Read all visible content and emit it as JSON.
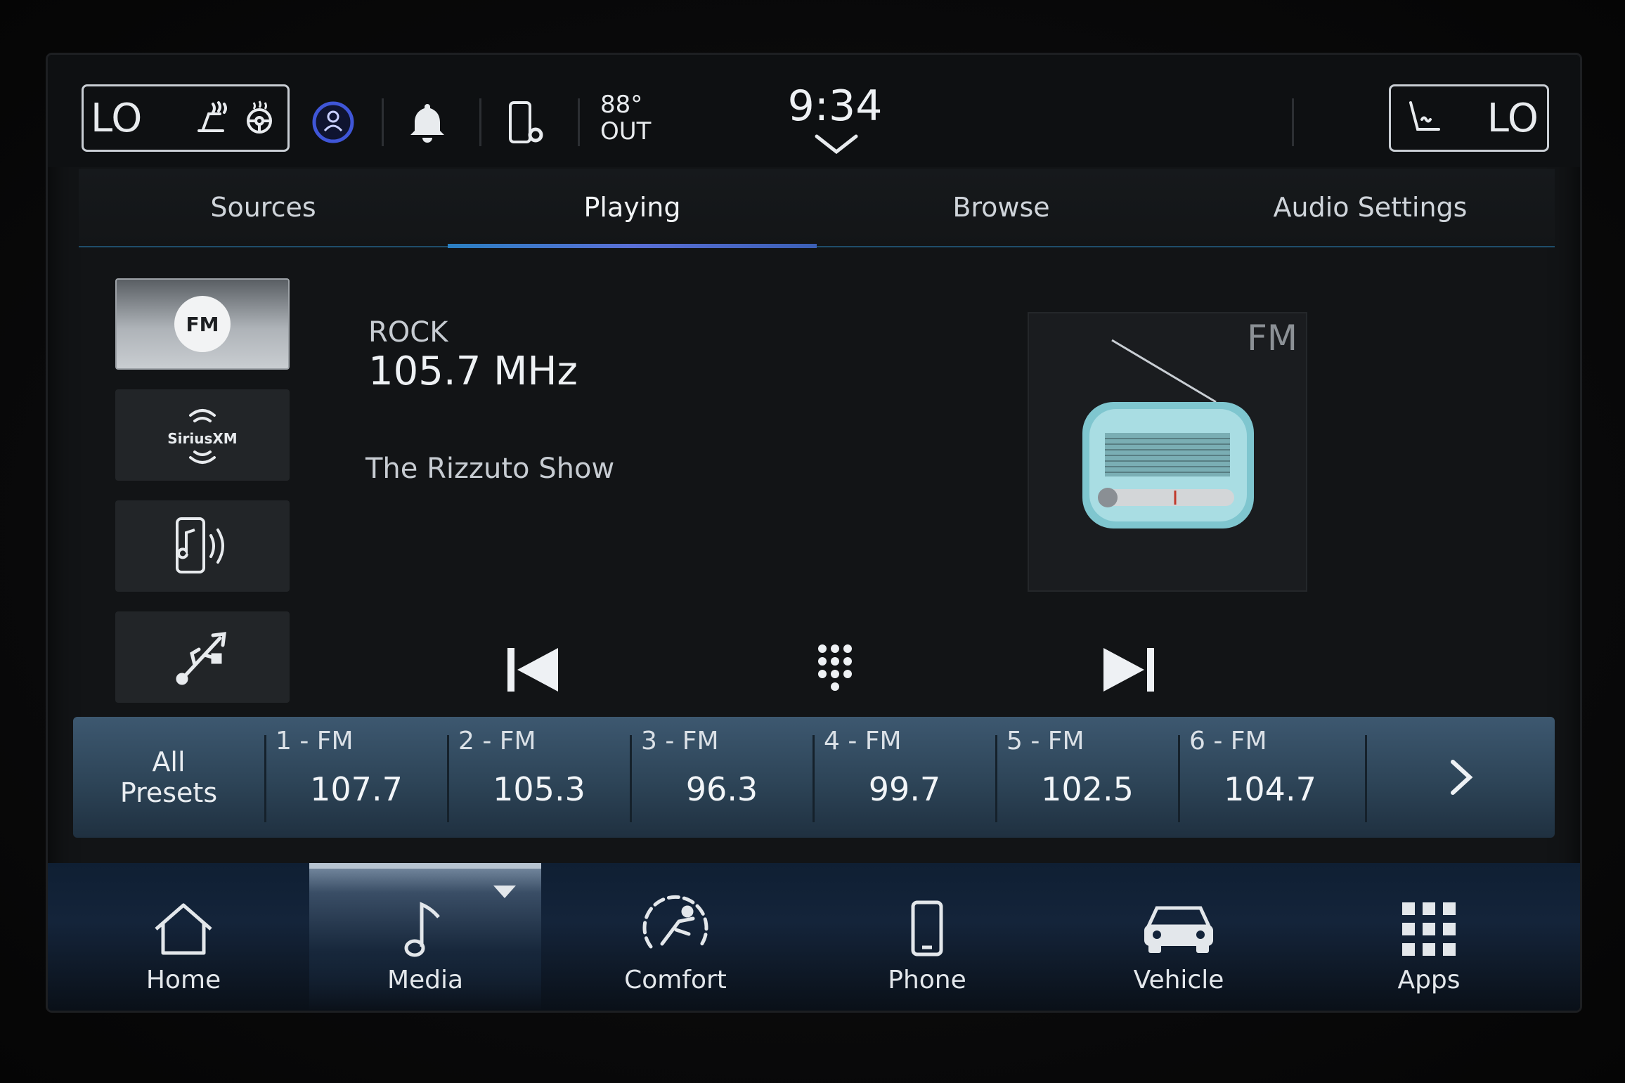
{
  "status_bar": {
    "driver_temp": "LO",
    "passenger_temp": "LO",
    "outside_temp": "88°",
    "outside_label": "OUT",
    "clock": "9:34"
  },
  "tabs": [
    {
      "label": "Sources"
    },
    {
      "label": "Playing",
      "active": true
    },
    {
      "label": "Browse"
    },
    {
      "label": "Audio Settings"
    }
  ],
  "sources": {
    "fm_label": "FM",
    "sirius_label": "SiriusXM"
  },
  "now_playing": {
    "genre": "ROCK",
    "frequency": "105.7 MHz",
    "program": "The Rizzuto Show",
    "art_label": "FM"
  },
  "presets": {
    "all_label_line1": "All",
    "all_label_line2": "Presets",
    "items": [
      {
        "name": "1 - FM",
        "value": "107.7"
      },
      {
        "name": "2 - FM",
        "value": "105.3"
      },
      {
        "name": "3 - FM",
        "value": "96.3"
      },
      {
        "name": "4 - FM",
        "value": "99.7"
      },
      {
        "name": "5 - FM",
        "value": "102.5"
      },
      {
        "name": "6 - FM",
        "value": "104.7"
      }
    ]
  },
  "nav": [
    {
      "label": "Home",
      "icon": "home-icon"
    },
    {
      "label": "Media",
      "icon": "music-note-icon",
      "active": true
    },
    {
      "label": "Comfort",
      "icon": "comfort-seat-icon"
    },
    {
      "label": "Phone",
      "icon": "phone-icon"
    },
    {
      "label": "Vehicle",
      "icon": "car-icon"
    },
    {
      "label": "Apps",
      "icon": "apps-grid-icon"
    }
  ],
  "colors": {
    "accent": "#2a7fc1",
    "preset_bar": "#3d5870",
    "background": "#121416"
  }
}
